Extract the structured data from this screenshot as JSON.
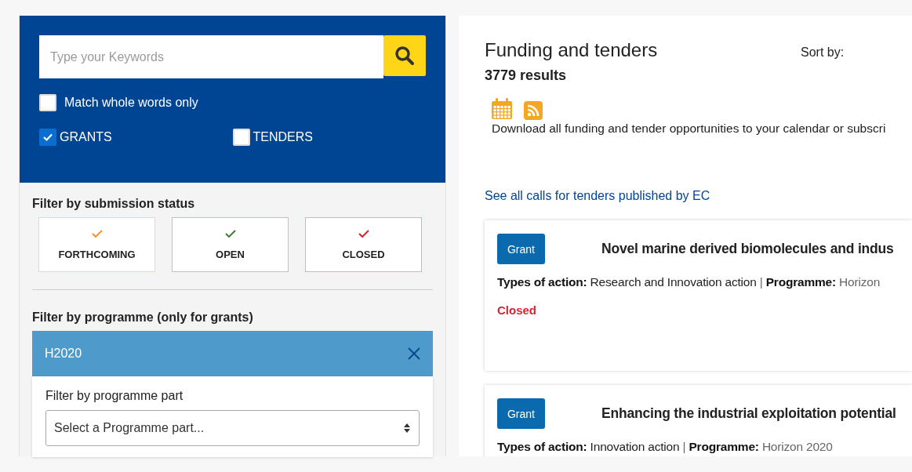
{
  "search": {
    "placeholder": "Type your Keywords"
  },
  "match_whole_words": {
    "label": "Match whole words only",
    "checked": false
  },
  "types": [
    {
      "label": "GRANTS",
      "checked": true
    },
    {
      "label": "TENDERS",
      "checked": false
    }
  ],
  "status_filter": {
    "title": "Filter by submission status",
    "options": [
      {
        "label": "FORTHCOMING",
        "color": "#f29527",
        "selected": false
      },
      {
        "label": "OPEN",
        "color": "#467a39",
        "selected": false
      },
      {
        "label": "CLOSED",
        "color": "#da2131",
        "selected": false
      }
    ]
  },
  "programme_filter": {
    "title": "Filter by programme (only for grants)",
    "chip": "H2020",
    "part_label": "Filter by programme part",
    "part_select": {
      "placeholder": "Select a Programme part..."
    }
  },
  "results": {
    "title": "Funding and tenders",
    "sort_label": "Sort by:",
    "count": "3779 results",
    "download_text": "Download all funding and tender opportunities to your calendar or subscri",
    "tenders_link": "See all calls for tenders published by EC",
    "cards": [
      {
        "badge": "Grant",
        "title": "Novel marine derived biomolecules and indus",
        "action_label": "Types of action:",
        "action": "Research and Innovation action",
        "separator": "|",
        "programme_label": "Programme:",
        "programme": "Horizon",
        "status": "Closed",
        "color": "#da2131"
      },
      {
        "badge": "Grant",
        "title": "Enhancing the industrial exploitation potential",
        "action_label": "Types of action:",
        "action": "Innovation action",
        "separator": "|",
        "programme_label": "Programme:",
        "programme": "Horizon 2020"
      }
    ]
  }
}
